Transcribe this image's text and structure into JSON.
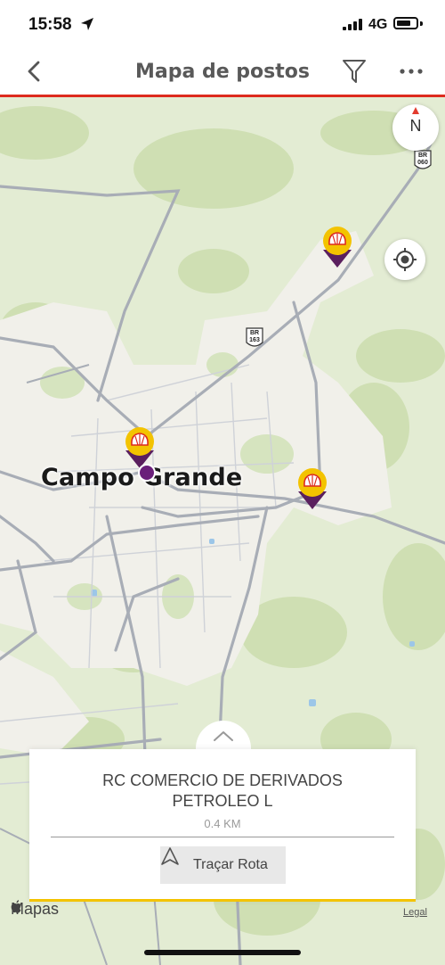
{
  "status": {
    "time": "15:58",
    "network": "4G"
  },
  "header": {
    "title": "Mapa de postos",
    "back_icon": "chevron-left-icon",
    "filter_icon": "filter-icon",
    "more_icon": "more-icon"
  },
  "map": {
    "city_label": "Campo Grande",
    "compass_label": "N",
    "highway_shields": [
      {
        "prefix": "BR",
        "number": "060"
      },
      {
        "prefix": "BR",
        "number": "163"
      }
    ],
    "station_pin_count": 3
  },
  "card": {
    "station_name_line1": "RC COMERCIO DE DERIVADOS",
    "station_name_line2": "PETROLEO L",
    "distance": "0.4 KM",
    "route_button_label": "Traçar Rota"
  },
  "footer": {
    "maps_label": "Mapas",
    "legal_label": "Legal"
  },
  "colors": {
    "accent_red": "#dd2b1e",
    "shell_yellow": "#f3c300",
    "pin_purple": "#5a1f5e",
    "map_green": "#dfe9cc",
    "road_gray": "#a8adb6"
  }
}
